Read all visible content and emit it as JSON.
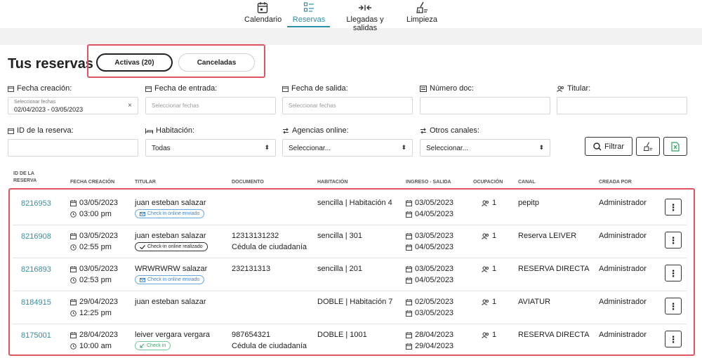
{
  "nav": {
    "items": [
      {
        "label": "Calendario",
        "icon": "calendar-icon",
        "active": false
      },
      {
        "label": "Reservas",
        "icon": "list-icon",
        "active": true
      },
      {
        "label": "Llegadas y salidas",
        "icon": "arrows-icon",
        "active": false
      },
      {
        "label": "Limpieza",
        "icon": "broom-icon",
        "active": false
      }
    ]
  },
  "page": {
    "title": "Tus reservas"
  },
  "tabs": {
    "active_label": "Activas (20)",
    "cancelled_label": "Canceladas"
  },
  "filters": {
    "fecha_creacion": {
      "label": "Fecha creación:",
      "small": "Seleccionar fechas",
      "value": "02/04/2023 - 03/05/2023",
      "clear": "×"
    },
    "fecha_entrada": {
      "label": "Fecha de entrada:",
      "placeholder": "Seleccionar fechas"
    },
    "fecha_salida": {
      "label": "Fecha de salida:",
      "placeholder": "Seleccionar fechas"
    },
    "numero_doc": {
      "label": "Número doc:"
    },
    "titular": {
      "label": "Titular:"
    },
    "id_reserva": {
      "label": "ID de la reserva:"
    },
    "habitacion": {
      "label": "Habitación:",
      "value": "Todas"
    },
    "agencias": {
      "label": "Agencias online:",
      "value": "Seleccionar..."
    },
    "otros": {
      "label": "Otros canales:",
      "value": "Seleccionar..."
    },
    "filter_button": "Filtrar"
  },
  "table": {
    "headers": {
      "id1": "ID DE LA",
      "id2": "RESERVA",
      "fecha": "FECHA CREACIÓN",
      "titular": "TITULAR",
      "documento": "DOCUMENTO",
      "habitacion": "HABITACIÓN",
      "ingreso": "INGRESO - SALIDA",
      "ocupacion": "OCUPACIÓN",
      "canal": "CANAL",
      "creada": "CREADA POR"
    },
    "rows": [
      {
        "id": "8216953",
        "date": "03/05/2023",
        "time": "03:00 pm",
        "titular": "juan esteban salazar",
        "badge": "Check in online enviado",
        "badge_type": "sent",
        "doc": "",
        "doc_type": "",
        "room": "sencilla | Habitación 4",
        "in": "03/05/2023",
        "out": "04/05/2023",
        "occ": "1",
        "canal": "pepitp",
        "creada": "Administrador"
      },
      {
        "id": "8216908",
        "date": "03/05/2023",
        "time": "02:55 pm",
        "titular": "juan esteban salazar",
        "badge": "Check-in online realizado",
        "badge_type": "done",
        "doc": "12313131232",
        "doc_type": "Cédula de ciudadanía",
        "room": "sencilla | 301",
        "in": "03/05/2023",
        "out": "04/05/2023",
        "occ": "1",
        "canal": "Reserva LEIVER",
        "creada": "Administrador"
      },
      {
        "id": "8216893",
        "date": "03/05/2023",
        "time": "02:53 pm",
        "titular": "WRWRWRW salazar",
        "badge": "Check in online enviado",
        "badge_type": "sent",
        "doc": "232131313",
        "doc_type": "",
        "room": "sencilla | 201",
        "in": "03/05/2023",
        "out": "04/05/2023",
        "occ": "1",
        "canal": "RESERVA DIRECTA",
        "creada": "Administrador"
      },
      {
        "id": "8184915",
        "date": "29/04/2023",
        "time": "12:25 pm",
        "titular": "juan esteban salazar",
        "badge": "",
        "badge_type": "",
        "doc": "",
        "doc_type": "",
        "room": "DOBLE | Habitación 7",
        "in": "02/05/2023",
        "out": "03/05/2023",
        "occ": "1",
        "canal": "AVIATUR",
        "creada": "Administrador"
      },
      {
        "id": "8175001",
        "date": "28/04/2023",
        "time": "10:00 am",
        "titular": "leiver vergara vergara",
        "badge": "Check in",
        "badge_type": "check",
        "doc": "987654321",
        "doc_type": "Cédula de ciudadanía",
        "room": "DOBLE | 1001",
        "in": "28/04/2023",
        "out": "29/04/2023",
        "occ": "1",
        "canal": "RESERVA DIRECTA",
        "creada": "Administrador"
      }
    ],
    "menu_glyph": "⋮"
  },
  "colors": {
    "accent": "#2e8fa8",
    "highlight": "#e05561",
    "badge_blue": "#3e83c7",
    "badge_green": "#3aa56c"
  }
}
